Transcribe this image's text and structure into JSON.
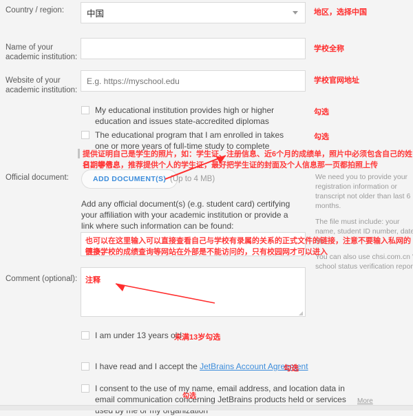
{
  "form": {
    "country": {
      "label": "Country / region:",
      "value": "中国",
      "annotation": "地区，选择中国"
    },
    "institution_name": {
      "label": "Name of your academic institution:",
      "value": "",
      "placeholder": "",
      "annotation": "学校全称"
    },
    "institution_website": {
      "label": "Website of your academic institution:",
      "value": "",
      "placeholder": "E.g. https://myschool.edu",
      "annotation": "学校官网地址"
    },
    "checkbox_education": {
      "label": "My educational institution provides high or higher education and issues state-accredited diplomas",
      "checked": false,
      "annotation": "勾选"
    },
    "checkbox_program": {
      "label": "The educational program that I am enrolled in takes one or more years of full-time study to complete",
      "checked": false,
      "annotation": "勾选"
    },
    "official_document": {
      "label": "Official document:",
      "button_label": "ADD DOCUMENT(S)",
      "size_hint": "(Up to 4 MB)",
      "annotation_line1": "提供证明自己是学生的照片，如：学生证、注册信息、近6个月的成绩单，照片中必须包含自己的姓名、学号、",
      "annotation_line2": "日期等信息，推荐提供个人的学生证，最好把学生证的封面及个人信息那一页都拍照上传"
    },
    "document_helper": "Add any official document(s) (e.g. student card) certifying your affiliation with your academic institution or provide a link where such information can be found:",
    "document_textarea": {
      "value": "",
      "annotation_line1": "也可以在这里输入可以直接查看自己与学校有录属的关系的正式文件的链接，注意不要输入私网的链接，",
      "annotation_line2": "很多学校的成绩查询等网站在外部是不能访问的，只有校园网才可以进入"
    },
    "comment": {
      "label": "Comment (optional):",
      "value": "",
      "annotation": "注释"
    },
    "checkbox_under13": {
      "label": "I am under 13 years old",
      "checked": false,
      "annotation": "未满13岁勾选"
    },
    "checkbox_agreement": {
      "label_before": "I have read and I accept the ",
      "link_text": "JetBrains Account Agreement",
      "checked": false,
      "annotation": "勾选"
    },
    "checkbox_consent": {
      "label": "I consent to the use of my name, email address, and location data in email communication concerning JetBrains products held or services used by me or my organization",
      "more_label": "More",
      "checked": false,
      "annotation": "勾选"
    }
  },
  "info_panel": {
    "paragraphs": [
      "We need you to provide your registration information or transcript not older than last 6 months.",
      "The file must include: your name, student ID number, date, etc.",
      "You can also use chsi.com.cn 's school status verification report."
    ]
  },
  "colors": {
    "annotation_red": "#ff2d2d",
    "link_blue": "#3b8cdb",
    "page_bg": "#f4f4f4",
    "input_border": "#d9d9d9"
  }
}
